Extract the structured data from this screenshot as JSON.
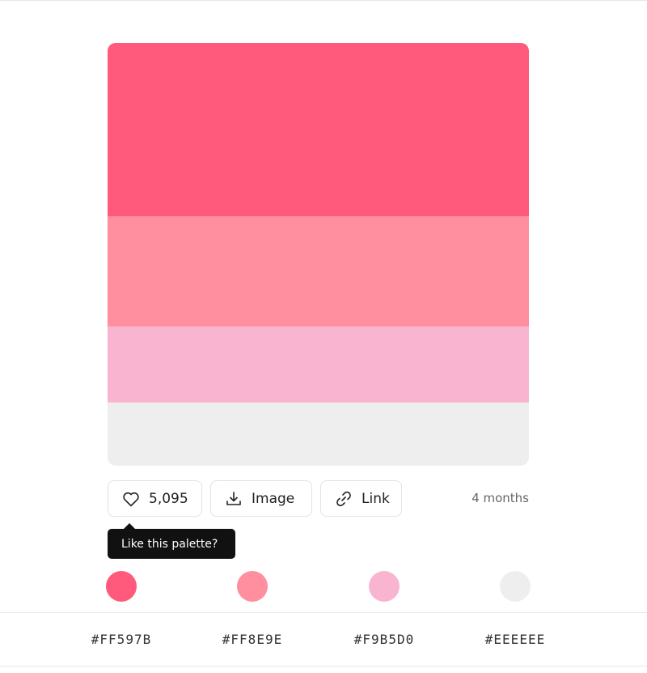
{
  "palette": {
    "colors": [
      "#FF597B",
      "#FF8E9E",
      "#F9B5D0",
      "#EEEEEE"
    ],
    "band_proportions": [
      0.41,
      0.26,
      0.18,
      0.15
    ]
  },
  "actions": {
    "like_count": "5,095",
    "image_label": "Image",
    "link_label": "Link",
    "age": "4 months"
  },
  "tooltip": {
    "text": "Like this palette?"
  },
  "hex_codes": {
    "c0": "#FF597B",
    "c1": "#FF8E9E",
    "c2": "#F9B5D0",
    "c3": "#EEEEEE"
  },
  "icons": {
    "like": "heart-icon",
    "image": "download-icon",
    "link": "link-icon"
  }
}
